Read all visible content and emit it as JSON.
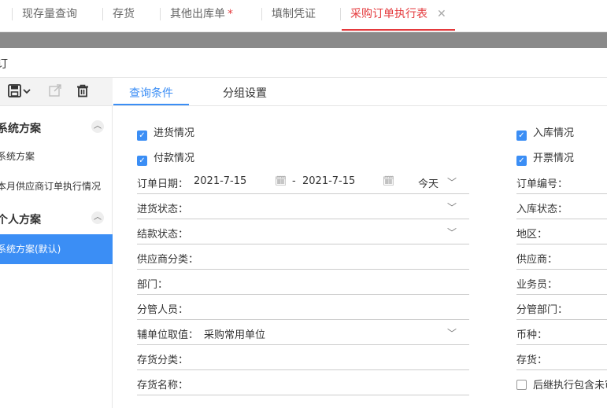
{
  "tabs": [
    {
      "label": "现存量查询"
    },
    {
      "label": "存货"
    },
    {
      "label": "其他出库单",
      "dirty": "*"
    },
    {
      "label": "填制凭证"
    },
    {
      "label": "采购订单执行表",
      "close": "✕"
    }
  ],
  "title": "订",
  "sidebar": {
    "toolbar": {
      "save_icon": "save-icon",
      "share_icon": "share-icon",
      "delete_icon": "trash-icon"
    },
    "groups": [
      {
        "label": "系统方案",
        "items": [
          "系统方案",
          "本月供应商订单执行情况"
        ]
      },
      {
        "label": "个人方案",
        "items": [
          "系统方案(默认)"
        ]
      }
    ]
  },
  "query_tabs": [
    {
      "label": "查询条件"
    },
    {
      "label": "分组设置"
    }
  ],
  "left_checks": [
    {
      "label": "进货情况",
      "checked": true
    },
    {
      "label": "付款情况",
      "checked": true
    }
  ],
  "right_checks": [
    {
      "label": "入库情况",
      "checked": true
    },
    {
      "label": "开票情况",
      "checked": true
    }
  ],
  "order_date": {
    "label": "订单日期：",
    "from": "2021-7-15",
    "sep": "-",
    "to": "2021-7-15",
    "preset": "今天"
  },
  "left_fields": [
    {
      "label": "进货状态：",
      "value": "",
      "dropdown": true
    },
    {
      "label": "结款状态：",
      "value": "",
      "dropdown": true
    },
    {
      "label": "供应商分类：",
      "value": ""
    },
    {
      "label": "部门：",
      "value": ""
    },
    {
      "label": "分管人员：",
      "value": ""
    },
    {
      "label": "辅单位取值：",
      "value": "采购常用单位",
      "dropdown": true
    },
    {
      "label": "存货分类：",
      "value": ""
    },
    {
      "label": "存货名称：",
      "value": ""
    }
  ],
  "right_fields": [
    {
      "label": "订单编号：",
      "value": ""
    },
    {
      "label": "入库状态：",
      "value": ""
    },
    {
      "label": "地区：",
      "value": ""
    },
    {
      "label": "供应商：",
      "value": ""
    },
    {
      "label": "业务员：",
      "value": ""
    },
    {
      "label": "分管部门：",
      "value": ""
    },
    {
      "label": "币种：",
      "value": ""
    },
    {
      "label": "存货：",
      "value": ""
    }
  ],
  "bottom_check": {
    "label": "后继执行包含未审",
    "checked": false
  }
}
